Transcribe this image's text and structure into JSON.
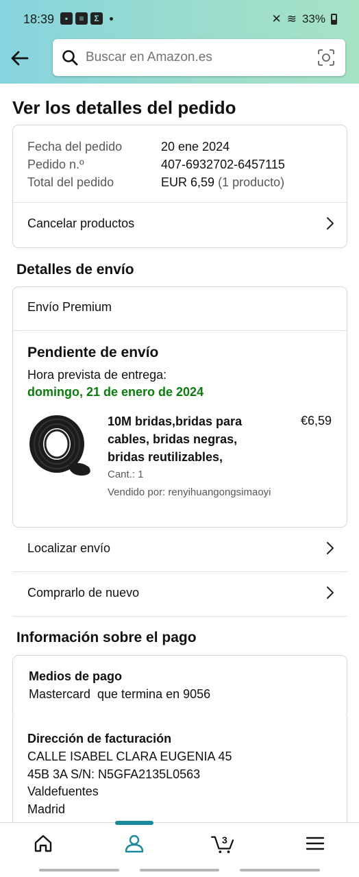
{
  "status_bar": {
    "time": "18:39",
    "battery": "33%"
  },
  "search": {
    "placeholder": "Buscar en Amazon.es"
  },
  "page": {
    "title": "Ver los detalles del pedido"
  },
  "order": {
    "date_label": "Fecha del pedido",
    "date_value": "20 ene 2024",
    "number_label": "Pedido n.º",
    "number_value": "407-6932702-6457115",
    "total_label": "Total del pedido",
    "total_value": "EUR 6,59",
    "total_extra": "(1 producto)",
    "cancel_label": "Cancelar productos"
  },
  "shipping": {
    "section_title": "Detalles de envío",
    "method": "Envío Premium",
    "status_title": "Pendiente de envío",
    "eta_label": "Hora prevista de entrega:",
    "eta_value": "domingo, 21 de enero de 2024",
    "product": {
      "title_line1": "10M bridas,bridas para",
      "title_line2": "cables, bridas negras,",
      "title_line3": "bridas reutilizables,",
      "price": "€6,59",
      "qty": "Cant.: 1",
      "seller": "Vendido por: renyihuangongsimaoyi"
    },
    "track_label": "Localizar envío",
    "buy_again_label": "Comprarlo de nuevo"
  },
  "payment": {
    "section_title": "Información sobre el pago",
    "methods_label": "Medios de pago",
    "methods_value": "Mastercard  que termina en 9056",
    "billing_label": "Dirección de facturación",
    "billing_lines": [
      "CALLE ISABEL CLARA EUGENIA 45",
      "45B 3A S/N: N5GFA2135L0563",
      "Valdefuentes",
      "Madrid"
    ]
  },
  "bottom_nav": {
    "cart_count": "3",
    "items": [
      "home-icon",
      "account-icon",
      "cart-icon",
      "menu-icon"
    ]
  },
  "colors": {
    "accent": "#1a8a9a",
    "delivery_green": "#0a7c0a",
    "header_start": "#86d4df",
    "header_end": "#a6e2c6"
  }
}
